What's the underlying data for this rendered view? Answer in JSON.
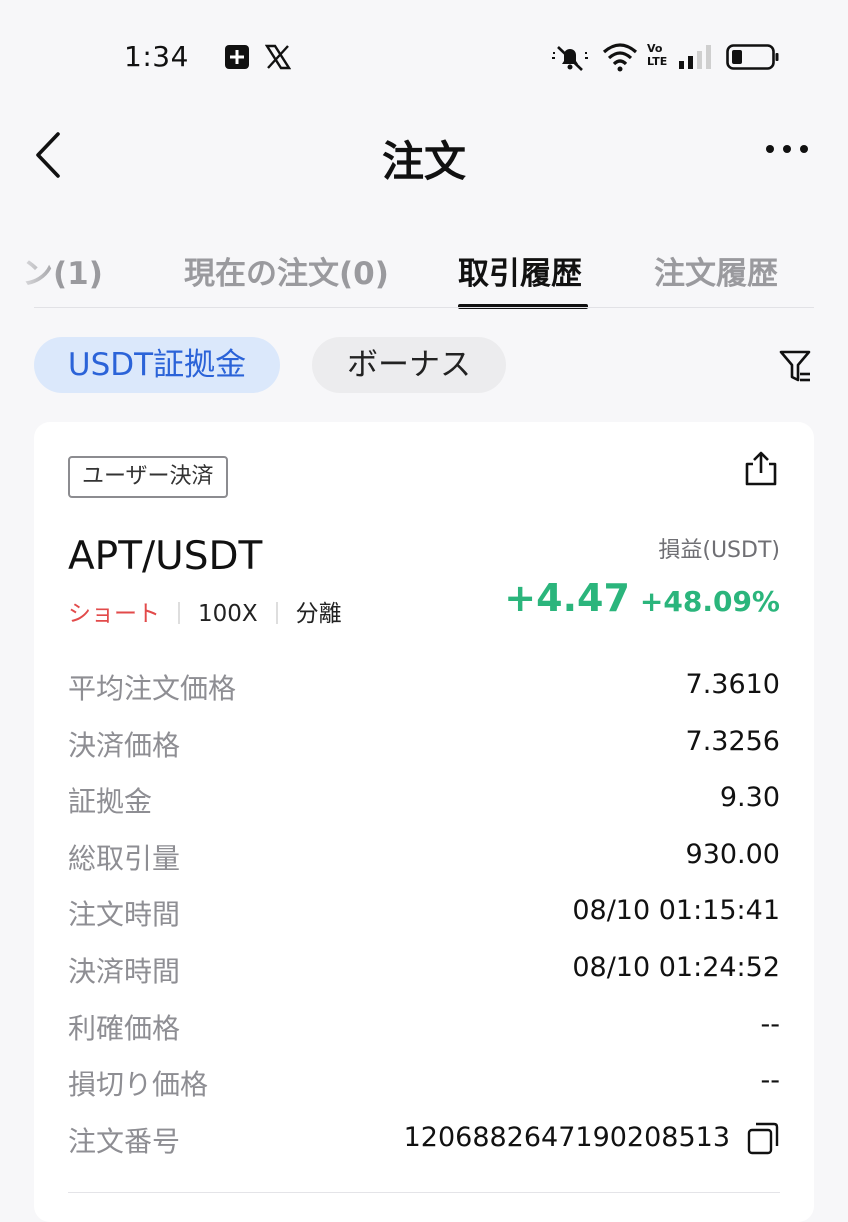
{
  "status_bar": {
    "time": "1:34",
    "icons": [
      "plus-square-icon",
      "x-logo-icon",
      "muted-bell-icon",
      "wifi-icon",
      "volte-icon",
      "signal-icon",
      "battery-icon"
    ],
    "volte_top": "Vo",
    "volte_bottom": "LTE"
  },
  "header": {
    "title": "注文",
    "back_icon": "chevron-left-icon",
    "more_icon": "more-dots-icon"
  },
  "tabs": [
    {
      "label": "ン(1)",
      "active": false
    },
    {
      "label": "現在の注文(0)",
      "active": false
    },
    {
      "label": "取引履歴",
      "active": true
    },
    {
      "label": "注文履歴",
      "active": false
    }
  ],
  "filters": {
    "chips": [
      {
        "label": "USDT証拠金",
        "selected": true
      },
      {
        "label": "ボーナス",
        "selected": false
      }
    ],
    "filter_icon": "filter-icon"
  },
  "card": {
    "tag": "ユーザー決済",
    "share_icon": "share-icon",
    "pair": "APT/USDT",
    "side": "ショート",
    "leverage": "100X",
    "margin_mode": "分離",
    "pnl_label": "損益(USDT)",
    "pnl_amount": "+4.47",
    "pnl_percent": "+48.09%",
    "details": [
      {
        "label": "平均注文価格",
        "value": "7.3610"
      },
      {
        "label": "決済価格",
        "value": "7.3256"
      },
      {
        "label": "証拠金",
        "value": "9.30"
      },
      {
        "label": "総取引量",
        "value": "930.00"
      },
      {
        "label": "注文時間",
        "value": "08/10 01:15:41"
      },
      {
        "label": "決済時間",
        "value": "08/10 01:24:52"
      },
      {
        "label": "利確価格",
        "value": "--"
      },
      {
        "label": "損切り価格",
        "value": "--"
      },
      {
        "label": "注文番号",
        "value": "1206882647190208513"
      }
    ]
  },
  "colors": {
    "profit_green": "#2bb57c",
    "short_red": "#e24a4a",
    "chip_blue_bg": "#dbe8fb",
    "chip_blue_text": "#2b63d8"
  }
}
